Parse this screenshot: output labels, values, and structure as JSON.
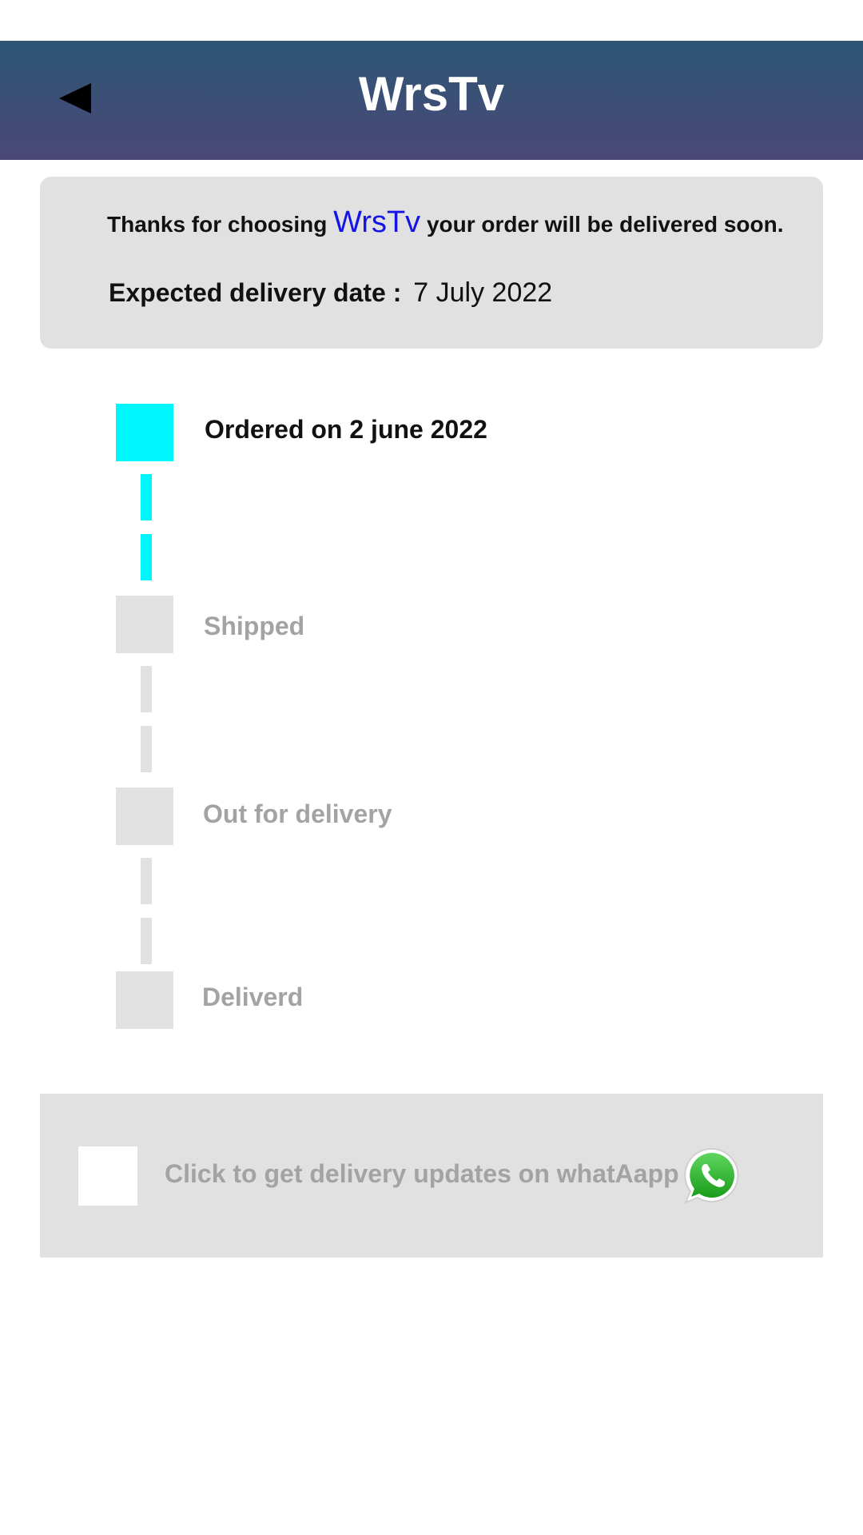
{
  "header": {
    "title": "WrsTv",
    "back_icon": "back-arrow-icon"
  },
  "info": {
    "thanks_prefix": "Thanks for choosing",
    "brand": "WrsTv",
    "thanks_suffix": "your order will be delivered soon.",
    "delivery_label": "Expected delivery date :",
    "delivery_date": "7 July 2022",
    "brand_color": "#1414e6"
  },
  "tracker": {
    "steps": [
      {
        "label": "Ordered on 2 june 2022",
        "completed": true
      },
      {
        "label": "Shipped",
        "completed": false
      },
      {
        "label": "Out for delivery",
        "completed": false
      },
      {
        "label": "Deliverd",
        "completed": false
      }
    ],
    "active_color": "#00f6ff",
    "inactive_color": "#e1e1e1"
  },
  "whatsapp": {
    "text": "Click to get delivery updates on whatAapp",
    "checked": false,
    "icon": "whatsapp-icon"
  }
}
